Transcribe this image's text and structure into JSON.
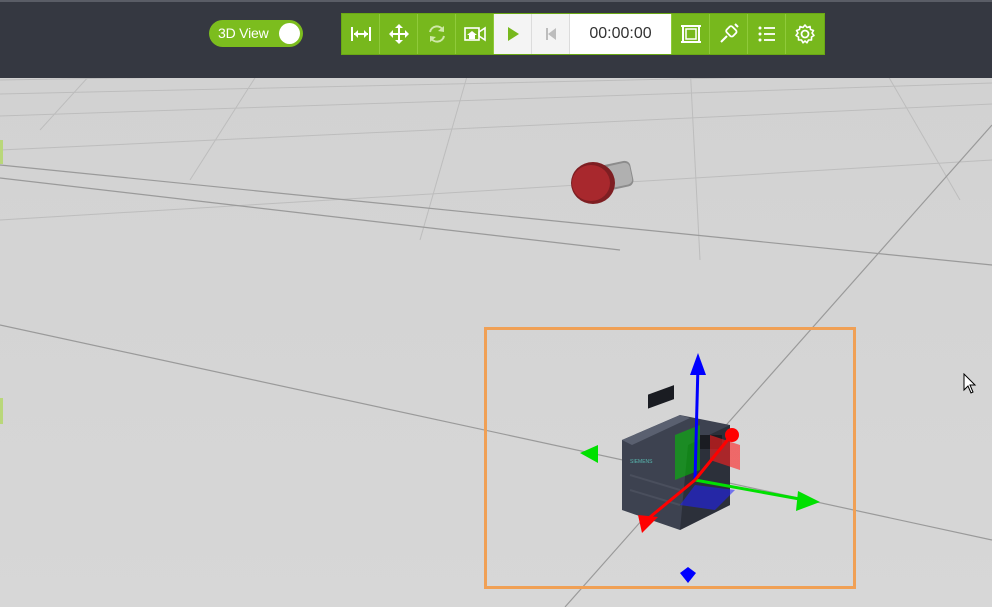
{
  "toggle": {
    "label": "3D View",
    "state": "on"
  },
  "toolbar": {
    "buttons": [
      {
        "name": "fit-width-icon"
      },
      {
        "name": "move-icon"
      },
      {
        "name": "rotate-icon"
      },
      {
        "name": "camera-home-icon"
      },
      {
        "name": "play-icon"
      },
      {
        "name": "skip-start-icon"
      },
      {
        "name": "frame-icon"
      },
      {
        "name": "connector-icon"
      },
      {
        "name": "list-icon"
      },
      {
        "name": "settings-icon"
      }
    ],
    "time": "00:00:00"
  },
  "scene": {
    "objects": [
      {
        "name": "emergency-stop-button",
        "color": "#a8282d"
      },
      {
        "name": "plc-module",
        "label": "SIEMENS"
      }
    ],
    "gizmo_colors": {
      "x": "#ff0000",
      "y": "#00e000",
      "z": "#0000ff"
    },
    "selection_color": "#f0a055"
  },
  "colors": {
    "accent": "#77b81d",
    "topbar": "#353841",
    "floor": "#d4d4d4"
  }
}
